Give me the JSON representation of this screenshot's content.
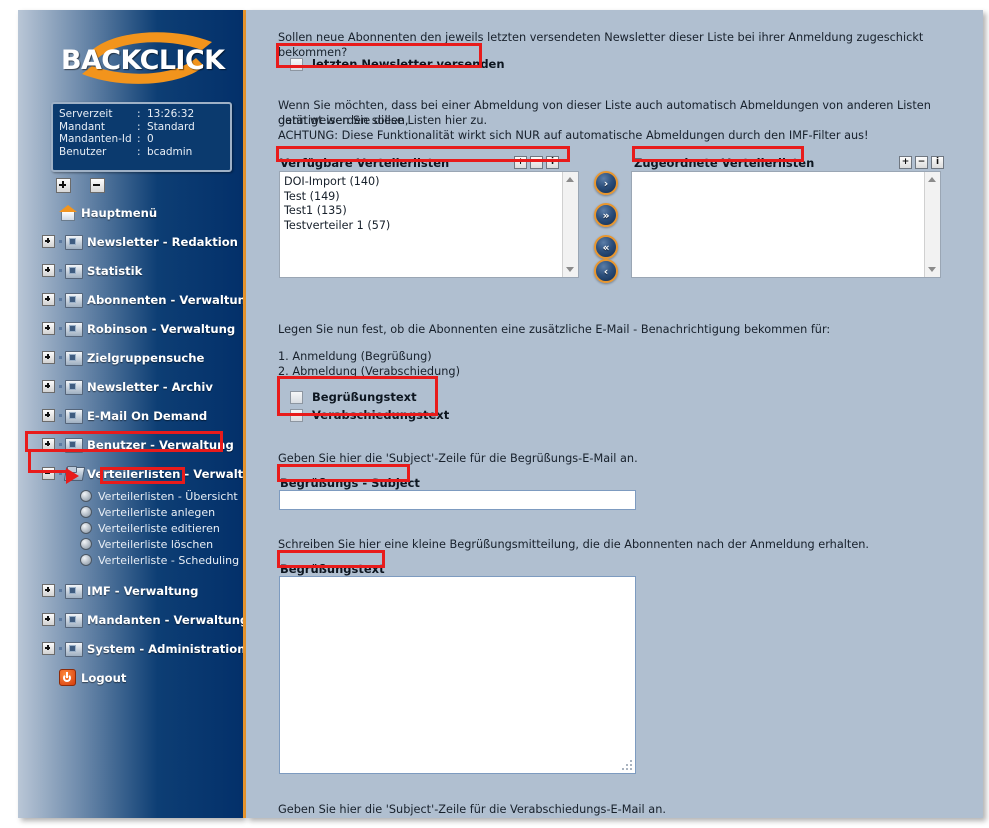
{
  "brand": {
    "logo_text": "BACKCLICK"
  },
  "infobox": {
    "rows": [
      {
        "key": "Serverzeit",
        "sep": ":",
        "value": "13:26:32"
      },
      {
        "key": "Mandant",
        "sep": ":",
        "value": "Standard"
      },
      {
        "key": "Mandanten-Id",
        "sep": ":",
        "value": "0"
      },
      {
        "key": "Benutzer",
        "sep": ":",
        "value": "bcadmin"
      }
    ]
  },
  "tree_tools": {
    "expand_all": "+",
    "collapse_all": "-"
  },
  "sidebar": {
    "items": [
      {
        "label": "Hauptmenü",
        "icon": "home-icon",
        "toggle": "none"
      },
      {
        "label": "Newsletter - Redaktion",
        "icon": "folder-icon",
        "toggle": "plus"
      },
      {
        "label": "Statistik",
        "icon": "folder-icon",
        "toggle": "plus"
      },
      {
        "label": "Abonnenten - Verwaltung",
        "icon": "folder-icon",
        "toggle": "plus"
      },
      {
        "label": "Robinson - Verwaltung",
        "icon": "folder-icon",
        "toggle": "plus"
      },
      {
        "label": "Zielgruppensuche",
        "icon": "folder-icon",
        "toggle": "plus"
      },
      {
        "label": "Newsletter - Archiv",
        "icon": "folder-icon",
        "toggle": "plus"
      },
      {
        "label": "E-Mail On Demand",
        "icon": "folder-icon",
        "toggle": "plus"
      },
      {
        "label": "Benutzer - Verwaltung",
        "icon": "folder-icon",
        "toggle": "plus"
      },
      {
        "label": "Verteilerlisten - Verwaltung",
        "icon": "folder-open-icon",
        "toggle": "minus"
      }
    ],
    "subitems": [
      {
        "label": "Verteilerlisten - Übersicht"
      },
      {
        "label": "Verteilerliste anlegen"
      },
      {
        "label": "Verteilerliste editieren"
      },
      {
        "label": "Verteilerliste löschen"
      },
      {
        "label": "Verteilerliste - Scheduling"
      }
    ],
    "items_after": [
      {
        "label": "IMF - Verwaltung",
        "icon": "folder-icon",
        "toggle": "plus"
      },
      {
        "label": "Mandanten - Verwaltung",
        "icon": "folder-icon",
        "toggle": "plus"
      },
      {
        "label": "System - Administration",
        "icon": "folder-icon",
        "toggle": "plus"
      },
      {
        "label": "Logout",
        "icon": "power-icon",
        "toggle": "none"
      }
    ]
  },
  "main": {
    "q1": "Sollen neue Abonnenten den jeweils letzten versendeten Newsletter dieser Liste bei ihrer Anmeldung zugeschickt bekommen?",
    "chk_last_newsletter": "letzten Newsletter versenden",
    "p2_line1": "Wenn Sie möchten, dass bei einer Abmeldung von dieser Liste auch automatisch Abmeldungen von anderen Listen getätigt werden sollen,",
    "p2_line2": "dann weisen Sie diese Listen hier zu.",
    "p2_line3": "ACHTUNG: Diese Funktionalität wirkt sich NUR auf automatische Abmeldungen durch den IMF-Filter aus!",
    "available_title": "Verfügbare Verteilerlisten",
    "assigned_title": "Zugeordnete Verteilerlisten",
    "available_options": [
      "DOI-Import (140)",
      "Test (149)",
      "Test1 (135)",
      "Testverteiler 1 (57)"
    ],
    "assigned_options": [],
    "tools": [
      {
        "glyph": "+",
        "name": "add"
      },
      {
        "glyph": "−",
        "name": "remove"
      },
      {
        "glyph": "i",
        "name": "info"
      }
    ],
    "transfer_buttons": [
      {
        "glyph": "›",
        "name": "move-right"
      },
      {
        "glyph": "»",
        "name": "move-all-right"
      },
      {
        "glyph": "«",
        "name": "move-all-left"
      },
      {
        "glyph": "‹",
        "name": "move-left"
      }
    ],
    "p3": "Legen Sie nun fest, ob die Abonnenten eine zusätzliche E-Mail - Benachrichtigung bekommen für:",
    "p3_item1": "1. Anmeldung (Begrüßung)",
    "p3_item2": "2. Abmeldung (Verabschiedung)",
    "chk_greeting": "Begrüßungstext",
    "chk_farewell": "Verabschiedungstext",
    "p4": "Geben Sie hier die 'Subject'-Zeile für die Begrüßungs-E-Mail an.",
    "label_greeting_subject": "Begrüßungs - Subject",
    "greeting_subject_value": "",
    "p5": "Schreiben Sie hier eine kleine Begrüßungsmitteilung, die die Abonnenten nach der Anmeldung erhalten.",
    "label_greeting_text": "Begrüßungstext",
    "greeting_text_value": "",
    "p6": "Geben Sie hier die 'Subject'-Zeile für die Verabschiedungs-E-Mail an."
  },
  "colors": {
    "sidebar_dark": "#03306a",
    "accent_orange": "#e8952c",
    "content_bg": "#b0bfd0",
    "annotation_red": "#e81b1b"
  }
}
